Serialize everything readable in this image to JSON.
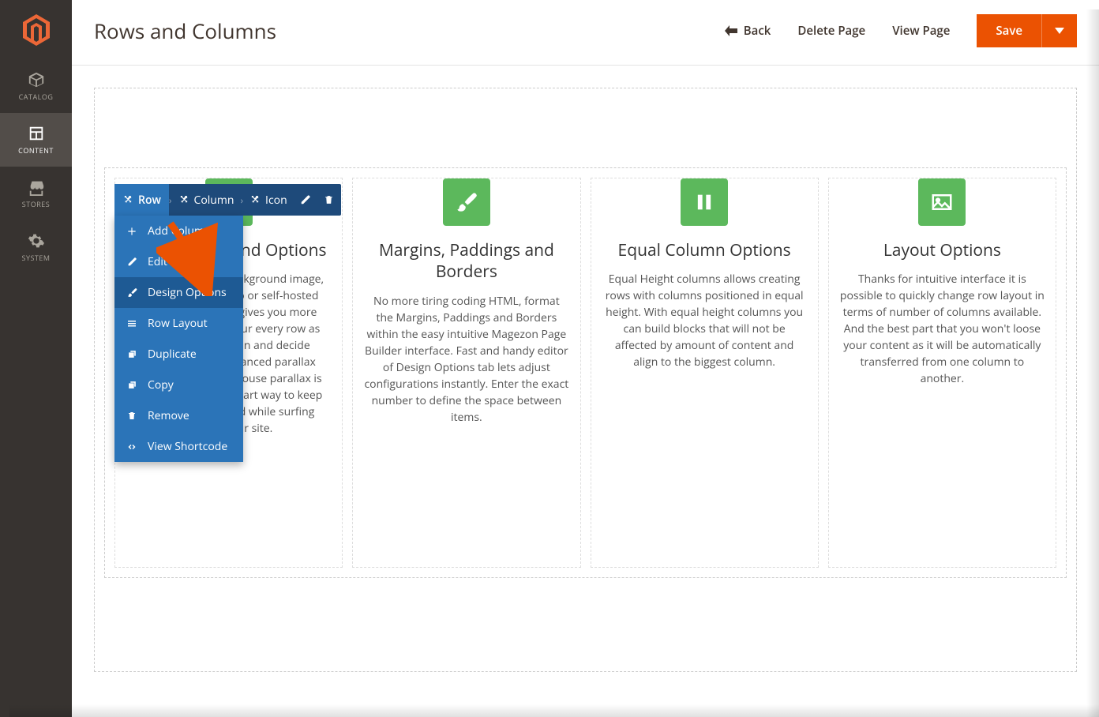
{
  "sidebar": {
    "items": [
      {
        "label": "CATALOG"
      },
      {
        "label": "CONTENT"
      },
      {
        "label": "STORES"
      },
      {
        "label": "SYSTEM"
      }
    ]
  },
  "header": {
    "title": "Rows and Columns",
    "back": "Back",
    "delete": "Delete Page",
    "view": "View Page",
    "save": "Save"
  },
  "breadcrumb": {
    "row": "Row",
    "column": "Column",
    "icon": "Icon"
  },
  "menu": {
    "add_column": "Add Column",
    "edit": "Edit",
    "design_options": "Design Options",
    "row_layout": "Row Layout",
    "duplicate": "Duplicate",
    "copy": "Copy",
    "remove": "Remove",
    "view_shortcode": "View Shortcode"
  },
  "columns": [
    {
      "title": "Row Background Options",
      "desc": "Select the type of background image, color, Youtube video or self-hosted video color palette gives you more flexibility to paint your every row as own. Set its position and decide whether to use advanced parallax effect or not. Plus, mouse parallax is also considered a smart way to keep your visitors excited while surfing around your site."
    },
    {
      "title": "Margins, Paddings and Borders",
      "desc": "No more tiring coding HTML, format the Margins, Paddings and Borders within the easy intuitive Magezon Page Builder interface. Fast and handy editor of Design Options tab lets adjust configurations instantly. Enter the exact number to define the space between items."
    },
    {
      "title": "Equal Column Options",
      "desc": "Equal Height columns allows creating rows with columns positioned in equal height. With equal height columns you can build blocks that will not be affected by amount of content and align to the biggest column."
    },
    {
      "title": "Layout Options",
      "desc": "Thanks for intuitive interface it is possible to quickly change row layout in terms of number of columns available. And the best part that you won't loose your content as it will be automatically transferred from one column to another."
    }
  ]
}
